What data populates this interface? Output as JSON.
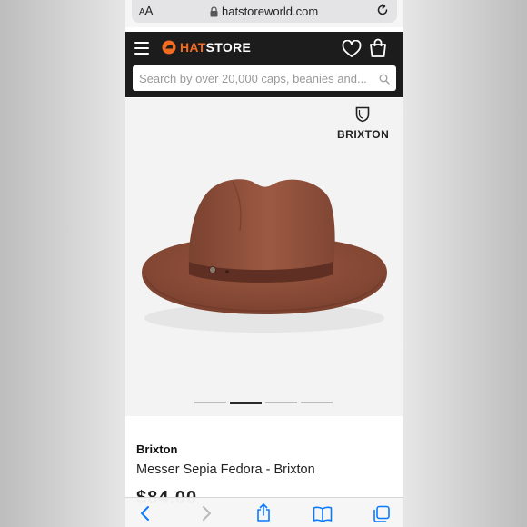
{
  "browser": {
    "text_size_button": "AA",
    "url": "hatstoreworld.com"
  },
  "header": {
    "logo_text_accent": "HAT",
    "logo_text": "STORE",
    "search_placeholder": "Search by over 20,000 caps, beanies and..."
  },
  "gallery": {
    "brand_logo": "BRIXTON",
    "image_count": 4,
    "active_index": 1
  },
  "product": {
    "brand": "Brixton",
    "title": "Messer Sepia Fedora - Brixton",
    "price_partial": "$84.00"
  },
  "icons": {
    "menu": "menu-icon",
    "heart": "heart-icon",
    "bag": "shopping-bag-icon",
    "search": "search-icon",
    "lock": "lock-icon",
    "reload": "reload-icon",
    "back": "back-arrow-icon",
    "forward": "forward-arrow-icon",
    "share": "share-icon",
    "bookmarks": "bookmarks-icon",
    "tabs": "tabs-icon"
  },
  "colors": {
    "brand_accent": "#f26b21",
    "header_bg": "#1c1c1c",
    "safari_blue": "#0a7aff",
    "hat": "#8a4b35"
  }
}
